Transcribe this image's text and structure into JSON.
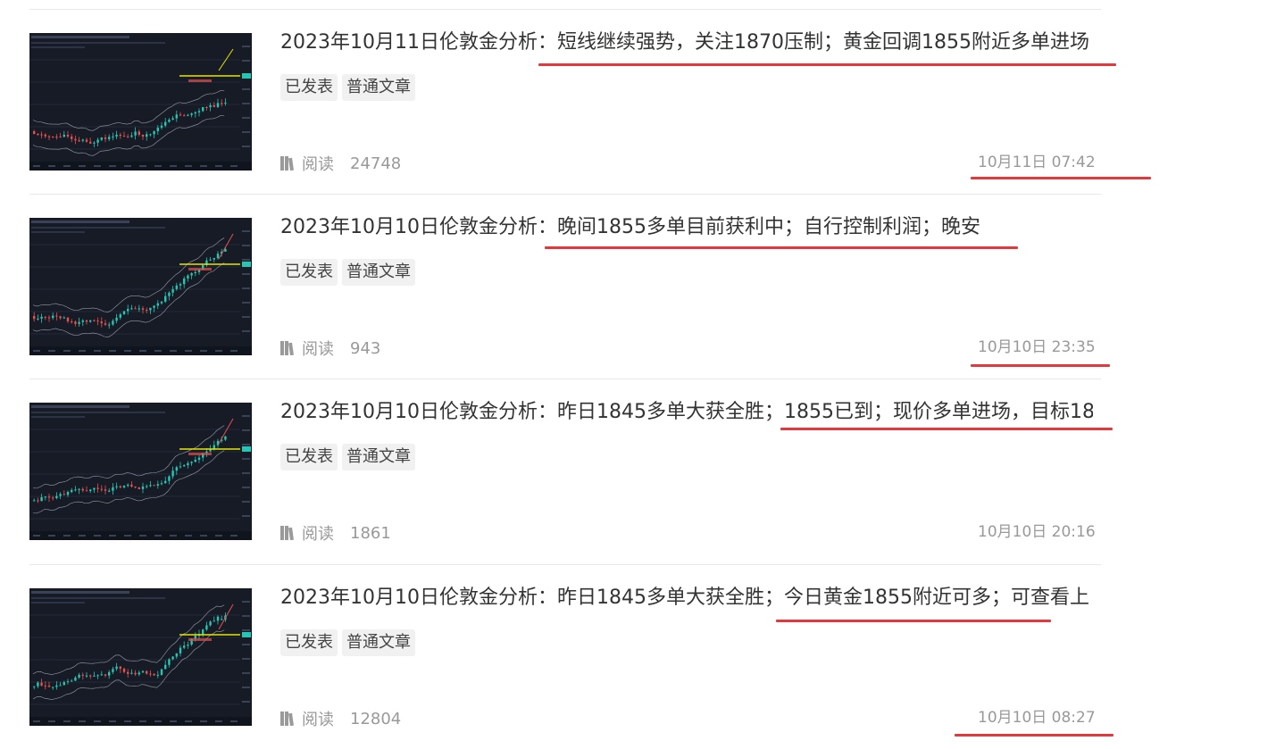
{
  "articles": [
    {
      "title": "2023年10月11日伦敦金分析：短线继续强势，关注1870压制；黄金回调1855附近多单进场",
      "tags": [
        "已发表",
        "普通文章"
      ],
      "read_label": "阅读",
      "read_count": "24748",
      "date": "10月11日 07:42"
    },
    {
      "title": "2023年10月10日伦敦金分析：晚间1855多单目前获利中；自行控制利润；晚安",
      "tags": [
        "已发表",
        "普通文章"
      ],
      "read_label": "阅读",
      "read_count": "943",
      "date": "10月10日 23:35"
    },
    {
      "title": "2023年10月10日伦敦金分析：昨日1845多单大获全胜；1855已到；现价多单进场，目标18",
      "tags": [
        "已发表",
        "普通文章"
      ],
      "read_label": "阅读",
      "read_count": "1861",
      "date": "10月10日 20:16"
    },
    {
      "title": "2023年10月10日伦敦金分析：昨日1845多单大获全胜；今日黄金1855附近可多；可查看上",
      "tags": [
        "已发表",
        "普通文章"
      ],
      "read_label": "阅读",
      "read_count": "12804",
      "date": "10月10日 08:27"
    }
  ],
  "colors": {
    "annotation_line": "#e4393c",
    "thumb_bg": "#161b26",
    "candle_up": "#26c6b5",
    "candle_down": "#e8504f",
    "level_line": "#e6e600"
  },
  "icons": {
    "read": "book-icon"
  }
}
